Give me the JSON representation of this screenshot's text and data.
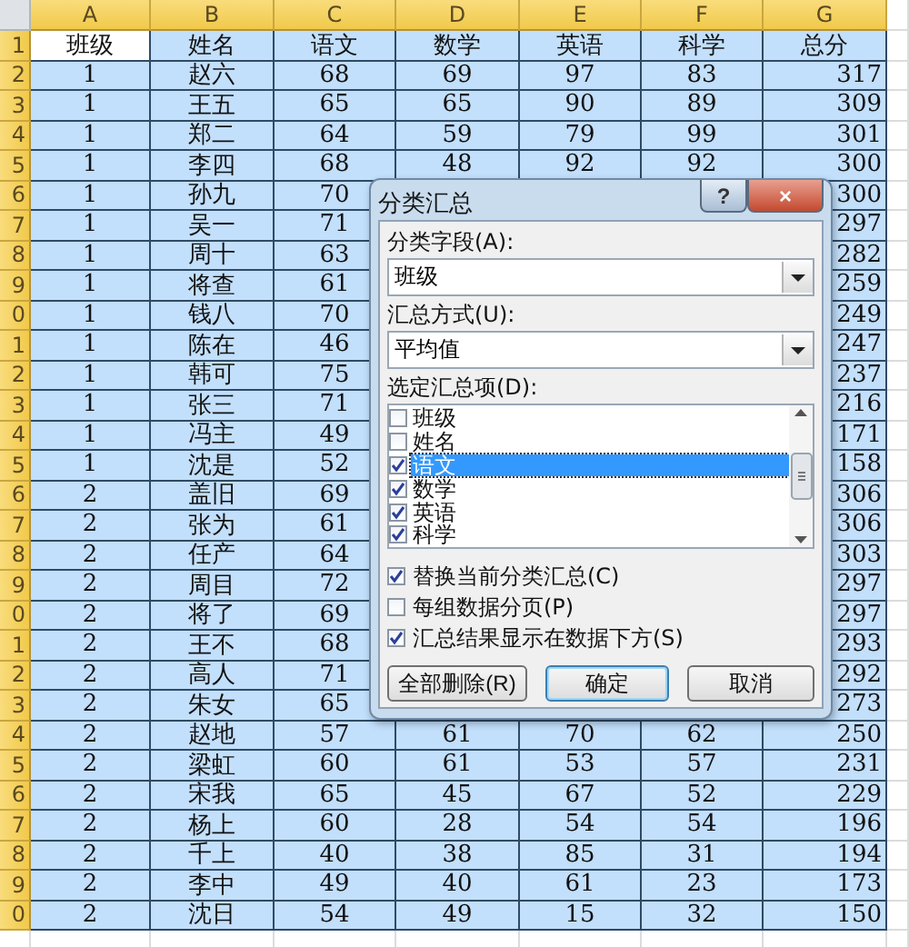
{
  "columns": [
    "A",
    "B",
    "C",
    "D",
    "E",
    "F",
    "G"
  ],
  "header_row": {
    "num": "1",
    "cells": [
      {
        "text": "班级",
        "active": true
      },
      {
        "text": "姓名",
        "active": false
      },
      {
        "text": "语文",
        "active": false
      },
      {
        "text": "数学",
        "active": false
      },
      {
        "text": "英语",
        "active": false
      },
      {
        "text": "科学",
        "active": false
      },
      {
        "text": "总分",
        "active": false
      }
    ]
  },
  "rows": [
    {
      "num": "2",
      "cells": [
        "1",
        "赵六",
        "68",
        "69",
        "97",
        "83",
        "317"
      ]
    },
    {
      "num": "3",
      "cells": [
        "1",
        "王五",
        "65",
        "65",
        "90",
        "89",
        "309"
      ]
    },
    {
      "num": "4",
      "cells": [
        "1",
        "郑二",
        "64",
        "59",
        "79",
        "99",
        "301"
      ]
    },
    {
      "num": "5",
      "cells": [
        "1",
        "李四",
        "68",
        "48",
        "92",
        "92",
        "300"
      ]
    },
    {
      "num": "6",
      "cells": [
        "1",
        "孙九",
        "70",
        null,
        null,
        null,
        "300"
      ]
    },
    {
      "num": "7",
      "cells": [
        "1",
        "吴一",
        "71",
        null,
        null,
        null,
        "297"
      ]
    },
    {
      "num": "8",
      "cells": [
        "1",
        "周十",
        "63",
        null,
        null,
        null,
        "282"
      ]
    },
    {
      "num": "9",
      "cells": [
        "1",
        "将查",
        "61",
        null,
        null,
        null,
        "259"
      ]
    },
    {
      "num": "0",
      "cells": [
        "1",
        "钱八",
        "70",
        null,
        null,
        null,
        "249"
      ]
    },
    {
      "num": "1",
      "cells": [
        "1",
        "陈在",
        "46",
        null,
        null,
        null,
        "247"
      ]
    },
    {
      "num": "2",
      "cells": [
        "1",
        "韩可",
        "75",
        null,
        null,
        null,
        "237"
      ]
    },
    {
      "num": "3",
      "cells": [
        "1",
        "张三",
        "71",
        null,
        null,
        null,
        "216"
      ]
    },
    {
      "num": "4",
      "cells": [
        "1",
        "冯主",
        "49",
        null,
        null,
        null,
        "171"
      ]
    },
    {
      "num": "5",
      "cells": [
        "1",
        "沈是",
        "52",
        null,
        null,
        null,
        "158"
      ]
    },
    {
      "num": "6",
      "cells": [
        "2",
        "盖旧",
        "69",
        null,
        null,
        null,
        "306"
      ]
    },
    {
      "num": "7",
      "cells": [
        "2",
        "张为",
        "61",
        null,
        null,
        null,
        "306"
      ]
    },
    {
      "num": "8",
      "cells": [
        "2",
        "任产",
        "64",
        null,
        null,
        null,
        "303"
      ]
    },
    {
      "num": "9",
      "cells": [
        "2",
        "周目",
        "72",
        null,
        null,
        null,
        "297"
      ]
    },
    {
      "num": "0",
      "cells": [
        "2",
        "将了",
        "69",
        null,
        null,
        null,
        "297"
      ]
    },
    {
      "num": "1",
      "cells": [
        "2",
        "王不",
        "68",
        null,
        null,
        null,
        "293"
      ]
    },
    {
      "num": "2",
      "cells": [
        "2",
        "高人",
        "71",
        null,
        null,
        null,
        "292"
      ]
    },
    {
      "num": "3",
      "cells": [
        "2",
        "朱女",
        "65",
        null,
        null,
        null,
        "273"
      ]
    },
    {
      "num": "4",
      "cells": [
        "2",
        "赵地",
        "57",
        "61",
        "70",
        "62",
        "250"
      ]
    },
    {
      "num": "5",
      "cells": [
        "2",
        "梁虹",
        "60",
        "61",
        "53",
        "57",
        "231"
      ]
    },
    {
      "num": "6",
      "cells": [
        "2",
        "宋我",
        "65",
        "45",
        "67",
        "52",
        "229"
      ]
    },
    {
      "num": "7",
      "cells": [
        "2",
        "杨上",
        "60",
        "28",
        "54",
        "54",
        "196"
      ]
    },
    {
      "num": "8",
      "cells": [
        "2",
        "千上",
        "40",
        "38",
        "85",
        "31",
        "194"
      ]
    },
    {
      "num": "9",
      "cells": [
        "2",
        "李中",
        "49",
        "40",
        "61",
        "23",
        "173"
      ]
    },
    {
      "num": "0",
      "cells": [
        "2",
        "沈日",
        "54",
        "49",
        "15",
        "32",
        "150"
      ]
    }
  ],
  "dialog": {
    "title": "分类汇总",
    "help": "?",
    "close": "×",
    "group_by": {
      "label": "分类字段(A):",
      "value": "班级"
    },
    "function": {
      "label": "汇总方式(U):",
      "value": "平均值"
    },
    "fields_label": "选定汇总项(D):",
    "fields": [
      {
        "label": "班级",
        "checked": false,
        "selected": false
      },
      {
        "label": "姓名",
        "checked": false,
        "selected": false
      },
      {
        "label": "语文",
        "checked": true,
        "selected": true
      },
      {
        "label": "数学",
        "checked": true,
        "selected": false
      },
      {
        "label": "英语",
        "checked": true,
        "selected": false
      },
      {
        "label": "科学",
        "checked": true,
        "selected": false
      }
    ],
    "options": [
      {
        "label": "替换当前分类汇总(C)",
        "checked": true
      },
      {
        "label": "每组数据分页(P)",
        "checked": false
      },
      {
        "label": "汇总结果显示在数据下方(S)",
        "checked": true
      }
    ],
    "buttons": [
      {
        "label": "全部删除(R)",
        "default": false
      },
      {
        "label": "确定",
        "default": true
      },
      {
        "label": "取消",
        "default": false
      }
    ]
  }
}
